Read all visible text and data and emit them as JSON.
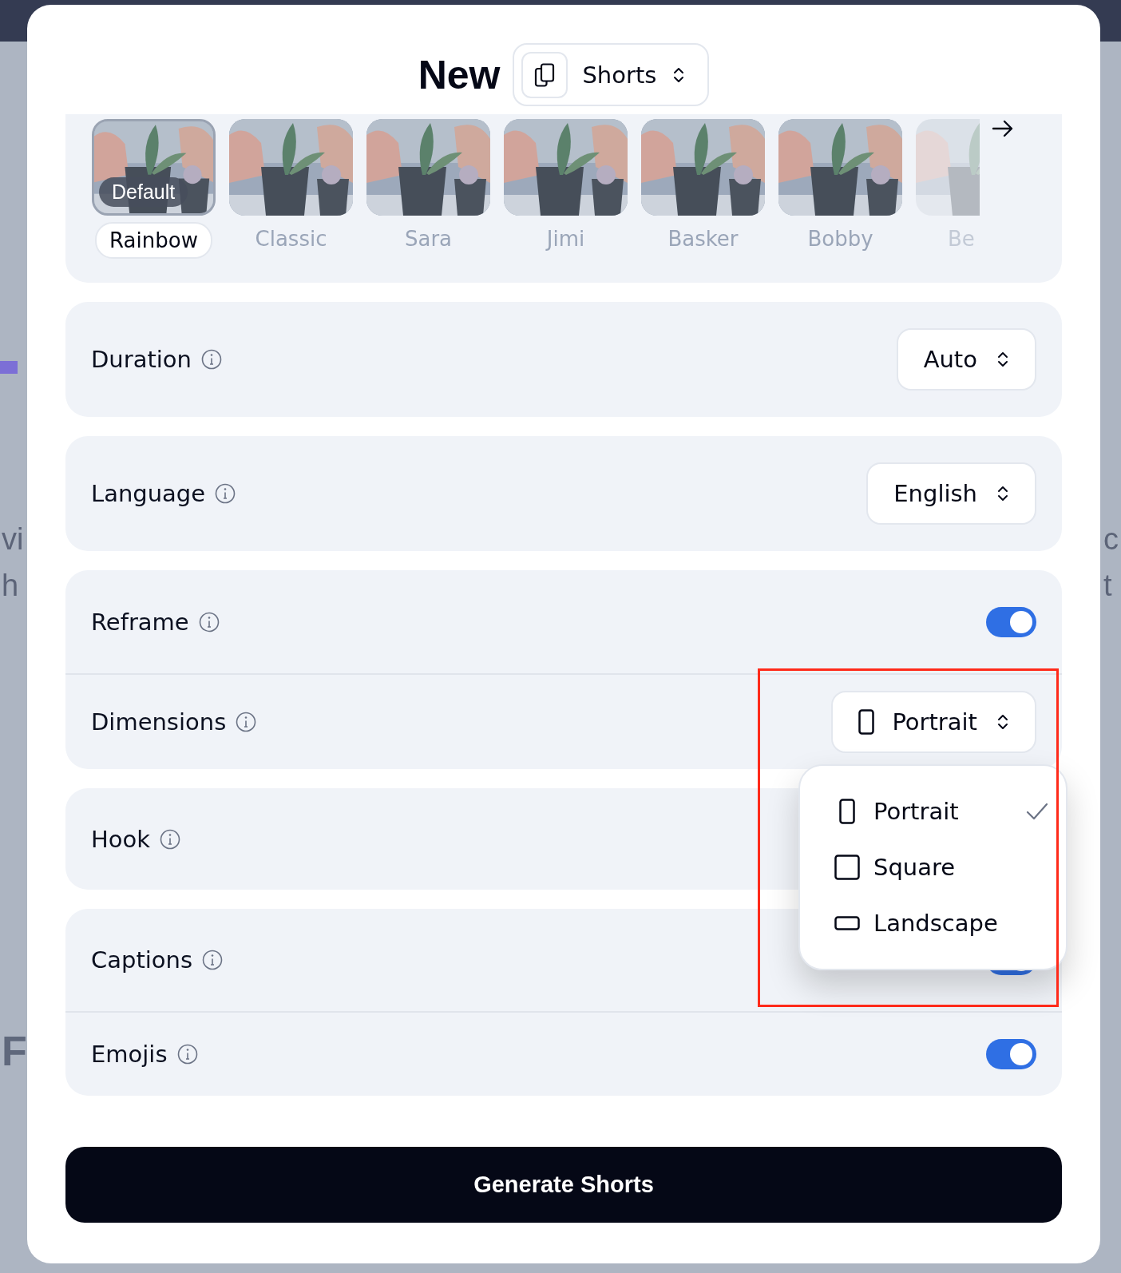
{
  "backdrop": {
    "left_texts": [
      "vi",
      "h"
    ],
    "big_letter": "F",
    "right_texts": [
      "c",
      "t"
    ]
  },
  "header": {
    "title": "New",
    "type_select": {
      "value": "Shorts"
    }
  },
  "caption_styles": [
    {
      "name": "Rainbow",
      "selected": true,
      "badge": "Default"
    },
    {
      "name": "Classic",
      "selected": false
    },
    {
      "name": "Sara",
      "selected": false
    },
    {
      "name": "Jimi",
      "selected": false
    },
    {
      "name": "Basker",
      "selected": false
    },
    {
      "name": "Bobby",
      "selected": false
    },
    {
      "name": "Be",
      "selected": false,
      "faded": true
    }
  ],
  "settings": [
    {
      "rows": [
        {
          "label": "Duration",
          "kind": "select",
          "value": "Auto"
        }
      ]
    },
    {
      "rows": [
        {
          "label": "Language",
          "kind": "select",
          "value": "English"
        }
      ]
    },
    {
      "rows": [
        {
          "label": "Reframe",
          "kind": "toggle",
          "on": true
        },
        {
          "label": "Dimensions",
          "kind": "select",
          "value": "Portrait",
          "icon_from_menu": true
        }
      ]
    },
    {
      "rows": [
        {
          "label": "Hook",
          "kind": "hidden"
        }
      ]
    },
    {
      "rows": [
        {
          "label": "Captions",
          "kind": "toggle",
          "on": true
        },
        {
          "label": "Emojis",
          "kind": "toggle",
          "on": true
        }
      ]
    }
  ],
  "dropdown": {
    "options": [
      {
        "label": "Portrait",
        "kind": "portrait",
        "selected": true
      },
      {
        "label": "Square",
        "kind": "square",
        "selected": false
      },
      {
        "label": "Landscape",
        "kind": "landscape",
        "selected": false
      }
    ]
  },
  "generate_button": "Generate Shorts",
  "annotation": {
    "kind": "highlight"
  }
}
